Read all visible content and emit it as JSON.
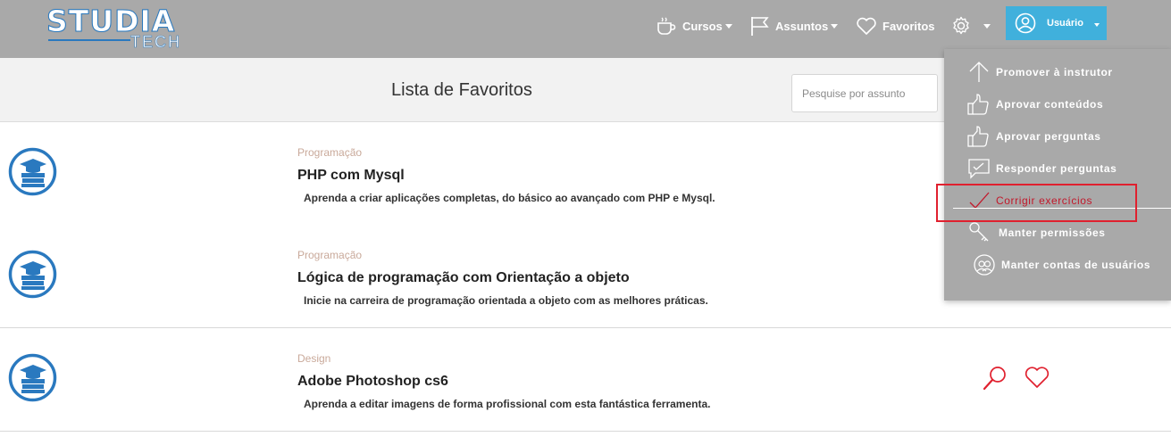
{
  "app": {
    "logo_main": "STUDIA",
    "logo_sub": "TECH"
  },
  "nav": {
    "cursos_label": "Cursos",
    "assuntos_label": "Assuntos",
    "favoritos_label": "Favoritos",
    "user_label": "Usuário"
  },
  "page": {
    "title": "Lista de Favoritos"
  },
  "search": {
    "placeholder": "Pesquise por assunto"
  },
  "courses": [
    {
      "category": "Programação",
      "title": "PHP com Mysql",
      "description": "Aprenda a criar aplicações completas, do básico ao avançado com PHP e Mysql."
    },
    {
      "category": "Programação",
      "title": "Lógica de programação com Orientação a objeto",
      "description": "Inicie na carreira de programação orientada a objeto com as melhores práticas."
    },
    {
      "category": "Design",
      "title": "Adobe Photoshop cs6",
      "description": "Aprenda a editar imagens de forma profissional com esta fantástica ferramenta."
    }
  ],
  "settings_menu": {
    "items": [
      {
        "label": "Promover à instrutor",
        "icon": "arrow-up-icon"
      },
      {
        "label": "Aprovar conteúdos",
        "icon": "thumbs-up-icon"
      },
      {
        "label": "Aprovar perguntas",
        "icon": "thumbs-up-icon"
      },
      {
        "label": "Responder perguntas",
        "icon": "chat-check-icon"
      },
      {
        "label": "Corrigir exercícios",
        "icon": "checkmark-icon",
        "active": true
      },
      {
        "label": "Manter permissões",
        "icon": "key-icon"
      },
      {
        "label": "Manter contas de usuários",
        "icon": "users-icon"
      }
    ]
  },
  "colors": {
    "navbar": "#a9a9a9",
    "user_button": "#40b0dc",
    "accent_red": "#e0202e",
    "category_text": "#c9a99a",
    "course_icon_blue": "#2a79bf"
  }
}
